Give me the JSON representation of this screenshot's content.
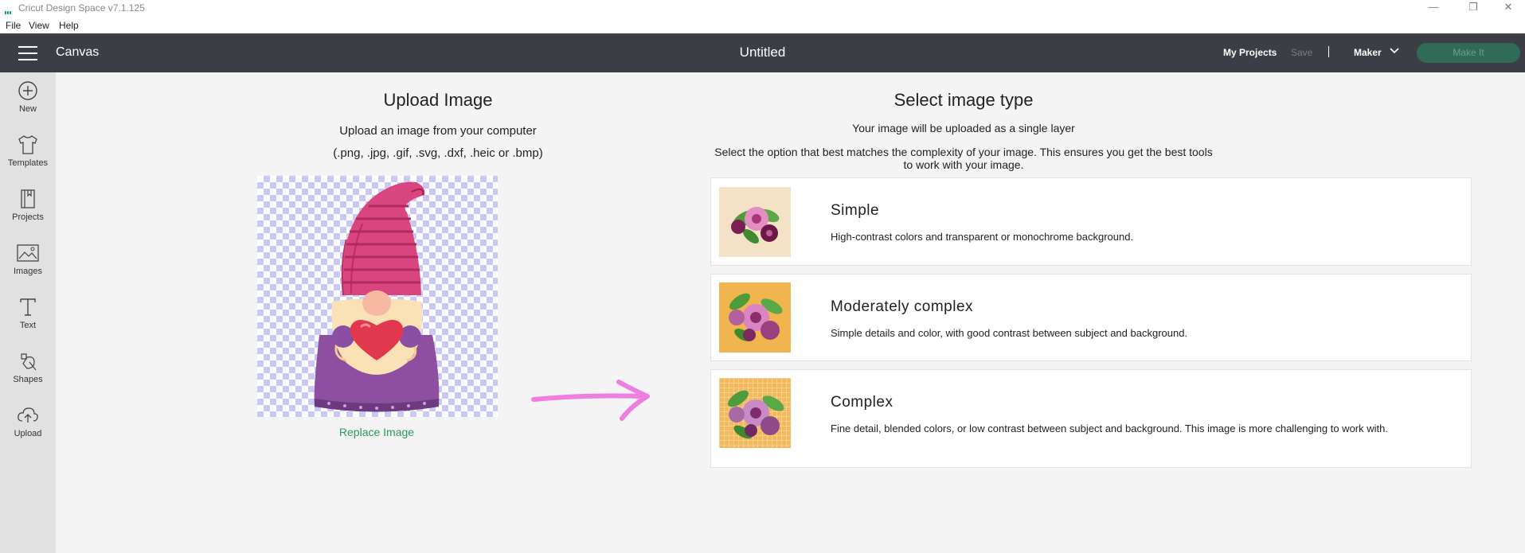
{
  "window": {
    "app_title": "Cricut Design Space  v7.1.125",
    "minimize": "—",
    "restore": "❐",
    "close": "✕"
  },
  "menu": {
    "file": "File",
    "view": "View",
    "help": "Help"
  },
  "topbar": {
    "canvas_label": "Canvas",
    "document_title": "Untitled",
    "my_projects": "My Projects",
    "save": "Save",
    "machine": "Maker",
    "make_it": "Make It"
  },
  "sidebar": {
    "items": [
      {
        "label": "New",
        "icon": "plus-circle-icon"
      },
      {
        "label": "Templates",
        "icon": "tshirt-icon"
      },
      {
        "label": "Projects",
        "icon": "notebook-icon"
      },
      {
        "label": "Images",
        "icon": "picture-icon"
      },
      {
        "label": "Text",
        "icon": "text-t-icon"
      },
      {
        "label": "Shapes",
        "icon": "shapes-icon"
      },
      {
        "label": "Upload",
        "icon": "cloud-upload-icon"
      }
    ]
  },
  "upload": {
    "title": "Upload Image",
    "subtitle": "Upload an image from your computer",
    "extensions": "(.png, .jpg, .gif, .svg, .dxf, .heic or .bmp)",
    "replace_label": "Replace Image"
  },
  "image_type": {
    "title": "Select image type",
    "subtitle": "Your image will be uploaded as a single layer",
    "instructions": "Select the option that best matches the complexity of your image. This ensures you get the best tools to work with your image.",
    "options": [
      {
        "name": "Simple",
        "description": "High-contrast colors and transparent or monochrome background.",
        "thumb_bg": "#f3e2c6"
      },
      {
        "name": "Moderately complex",
        "description": "Simple details and color, with good contrast between subject and background.",
        "thumb_bg": "#f0b54e"
      },
      {
        "name": "Complex",
        "description": "Fine detail, blended colors, or low contrast between subject and background. This image is more challenging to work with.",
        "thumb_bg": "#f2b95c"
      }
    ]
  },
  "colors": {
    "topbar": "#3b3f45",
    "sidebar": "#e1e1e1",
    "accent_green": "#2a9a5e",
    "arrow_pink": "#f07ee0"
  }
}
